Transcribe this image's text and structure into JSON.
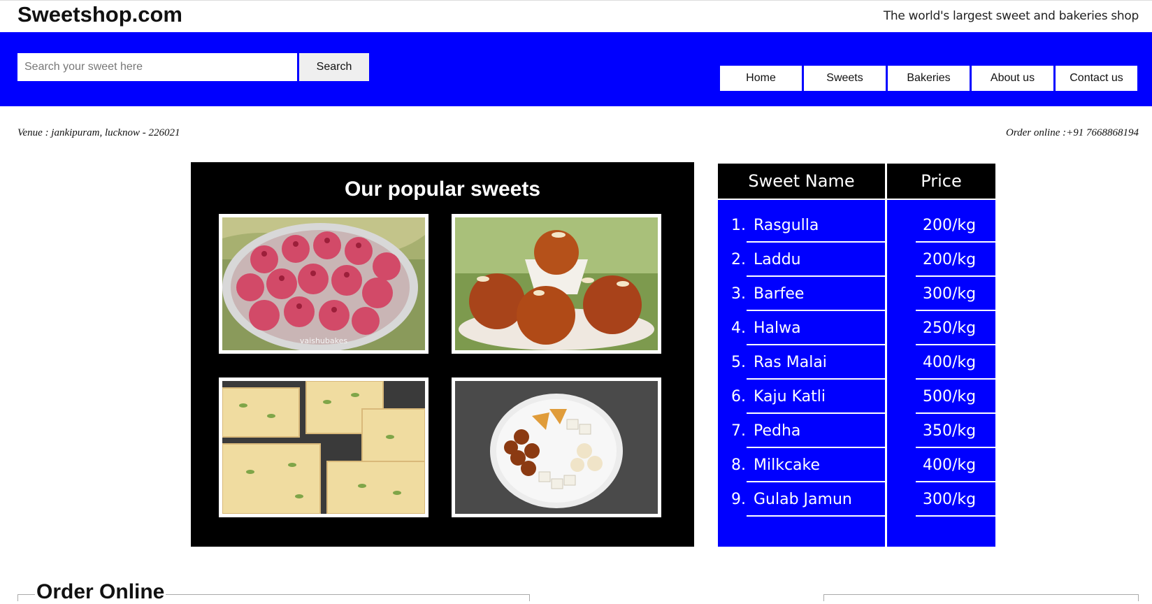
{
  "header": {
    "brand": "Sweetshop.com",
    "tagline": "The world's largest sweet and bakeries shop"
  },
  "search": {
    "placeholder": "Search your sweet here",
    "value": "",
    "button_label": "Search"
  },
  "nav": {
    "items": [
      {
        "label": "Home"
      },
      {
        "label": "Sweets"
      },
      {
        "label": "Bakeries"
      },
      {
        "label": "About us"
      },
      {
        "label": "Contact us"
      }
    ]
  },
  "info": {
    "venue": "Venue : jankipuram, lucknow - 226021",
    "order_phone": "Order online :+91 7668868194"
  },
  "gallery": {
    "title": "Our popular sweets",
    "photos": [
      {
        "name": "coconut-ladoo-photo",
        "watermark": "vaishubakes"
      },
      {
        "name": "gulab-jamun-photo"
      },
      {
        "name": "barfi-photo"
      },
      {
        "name": "mixed-sweets-platter-photo"
      }
    ]
  },
  "price_table": {
    "headers": {
      "name": "Sweet Name",
      "price": "Price"
    },
    "rows": [
      {
        "num": "1.",
        "name": "Rasgulla",
        "price": "200/kg"
      },
      {
        "num": "2.",
        "name": "Laddu",
        "price": "200/kg"
      },
      {
        "num": "3.",
        "name": "Barfee",
        "price": "300/kg"
      },
      {
        "num": "4.",
        "name": "Halwa",
        "price": "250/kg"
      },
      {
        "num": "5.",
        "name": "Ras Malai",
        "price": "400/kg"
      },
      {
        "num": "6.",
        "name": "Kaju Katli",
        "price": "500/kg"
      },
      {
        "num": "7.",
        "name": "Pedha",
        "price": "350/kg"
      },
      {
        "num": "8.",
        "name": "Milkcake",
        "price": "400/kg"
      },
      {
        "num": "9.",
        "name": "Gulab Jamun",
        "price": "300/kg"
      }
    ]
  },
  "order_section": {
    "heading": "Order Online"
  },
  "colors": {
    "band": "#0000ff",
    "gallery_bg": "#000000",
    "table_bg": "#0000ff"
  }
}
